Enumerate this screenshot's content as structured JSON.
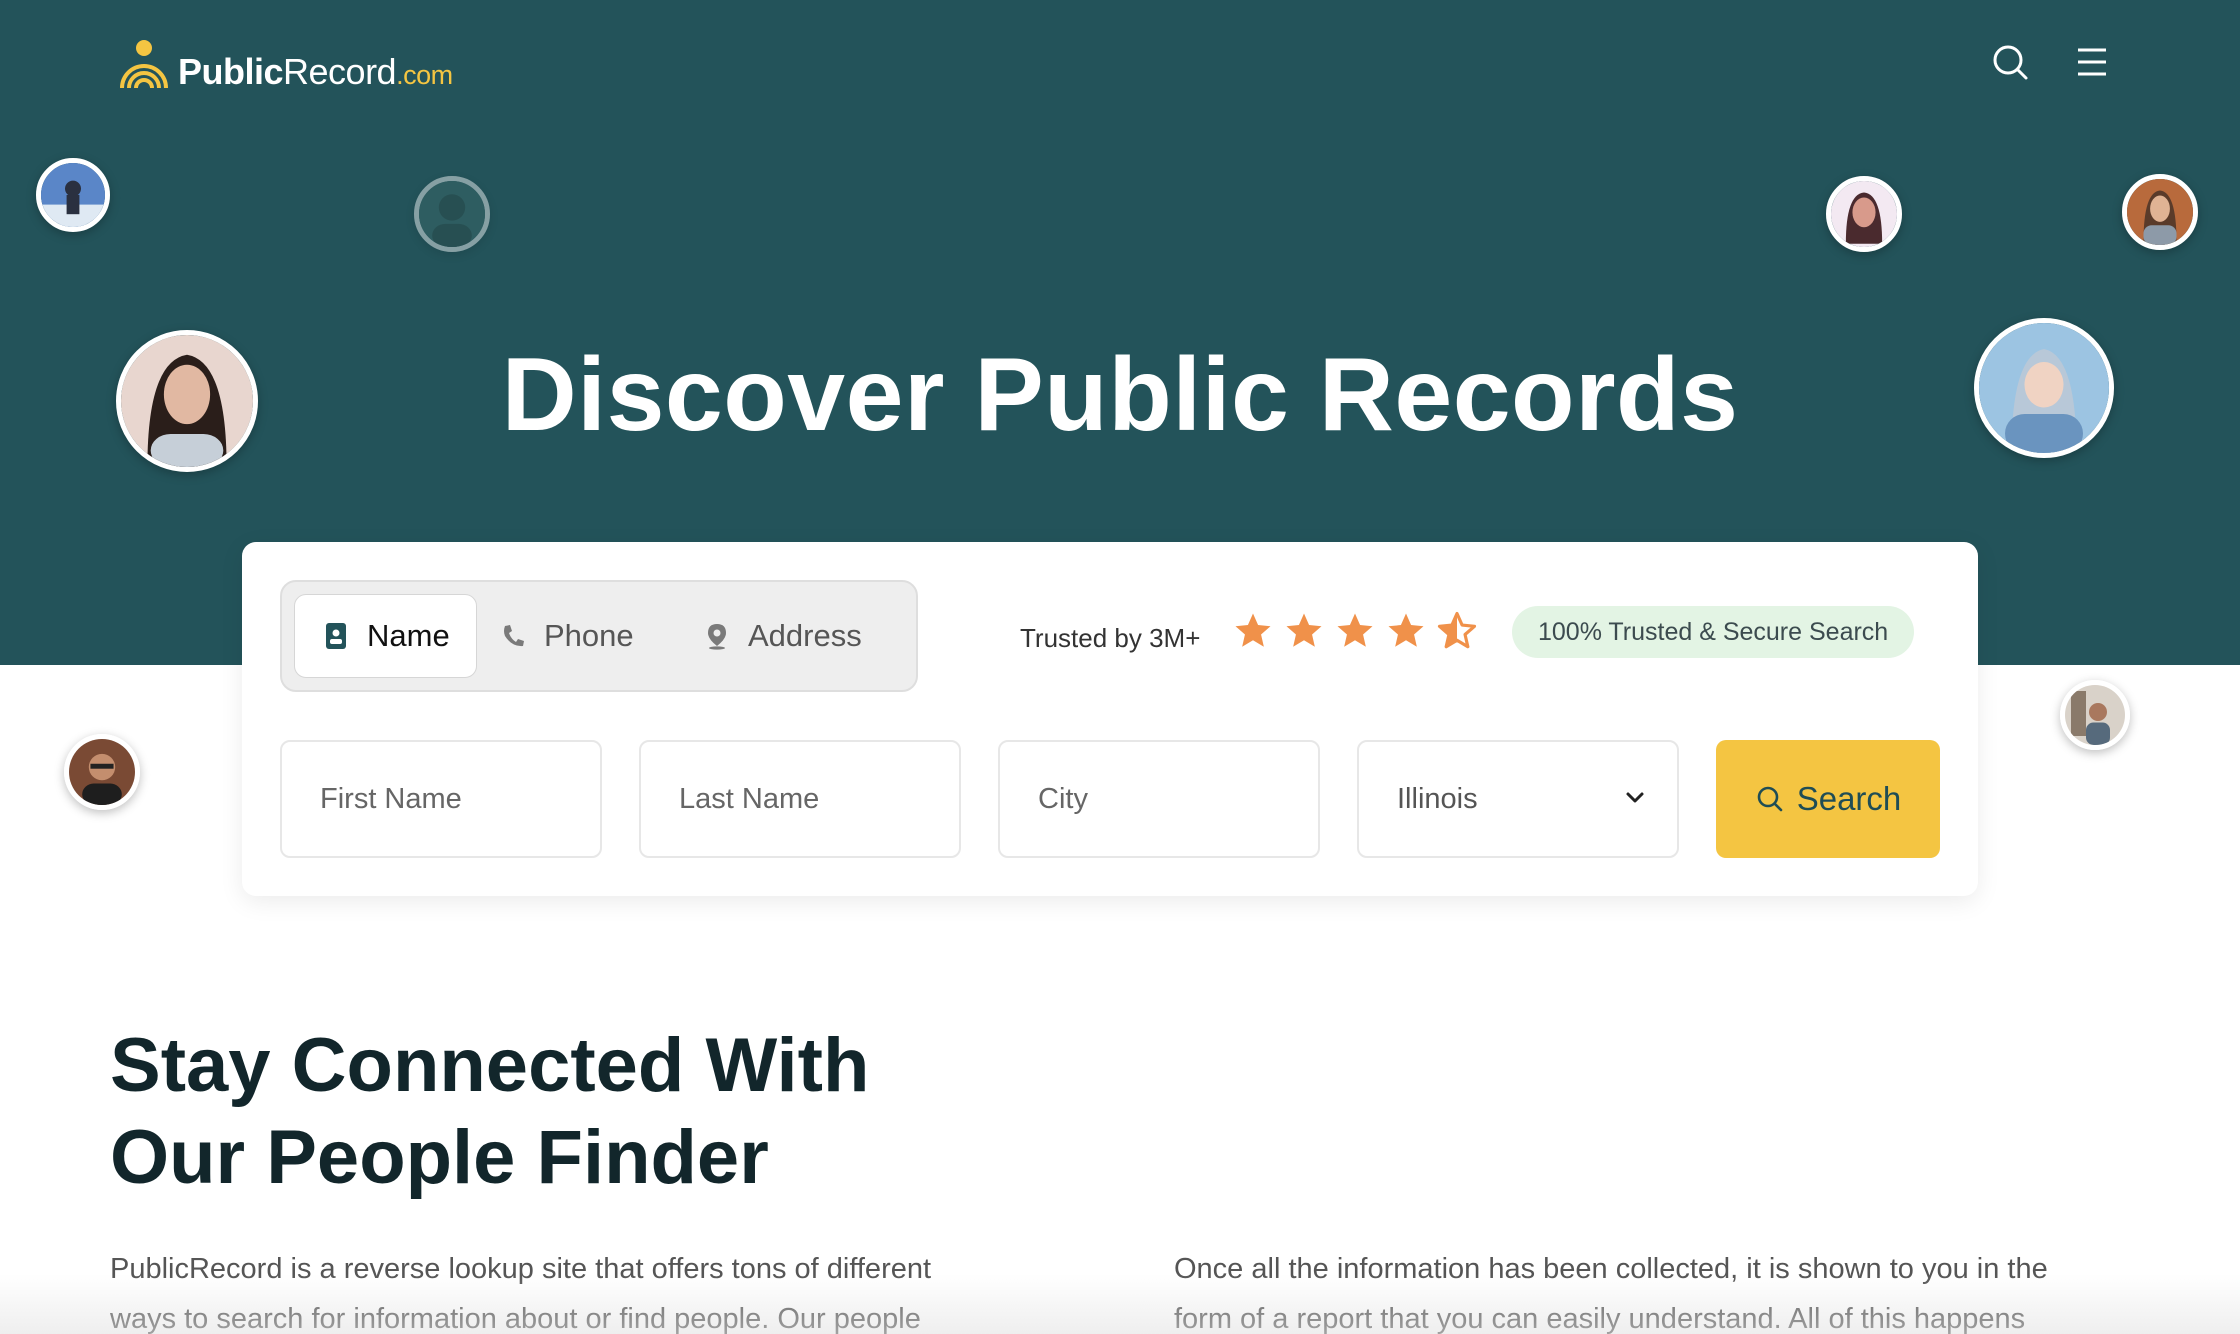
{
  "header": {
    "logo": {
      "brand_bold": "Public",
      "brand_light": "Record",
      "brand_tld": ".com"
    },
    "search_icon": "search-icon",
    "menu_icon": "hamburger-menu-icon"
  },
  "hero": {
    "title": "Discover Public Records",
    "background_color": "#23535a"
  },
  "search_card": {
    "tabs": [
      {
        "label": "Name",
        "icon": "id-card-icon",
        "active": true
      },
      {
        "label": "Phone",
        "icon": "phone-icon",
        "active": false
      },
      {
        "label": "Address",
        "icon": "map-pin-icon",
        "active": false
      }
    ],
    "trust_text": "Trusted by 3M+",
    "rating": {
      "stars": 4.5,
      "max": 5,
      "color": "#f0914a"
    },
    "secure_badge": "100% Trusted & Secure Search",
    "fields": {
      "first_name_placeholder": "First Name",
      "last_name_placeholder": "Last Name",
      "city_placeholder": "City",
      "state_value": "Illinois"
    },
    "search_button": "Search",
    "accent_color": "#f4c542"
  },
  "content": {
    "section_title_line1": "Stay Connected With",
    "section_title_line2": "Our People Finder",
    "para_left_line1": "PublicRecord is a reverse lookup site that offers tons of different",
    "para_left_line2": "ways to search for information about or find people. Our people",
    "para_right_line1": "Once all the information has been collected, it is shown to you in the",
    "para_right_line2": "form of a report that you can easily understand. All of this happens"
  }
}
